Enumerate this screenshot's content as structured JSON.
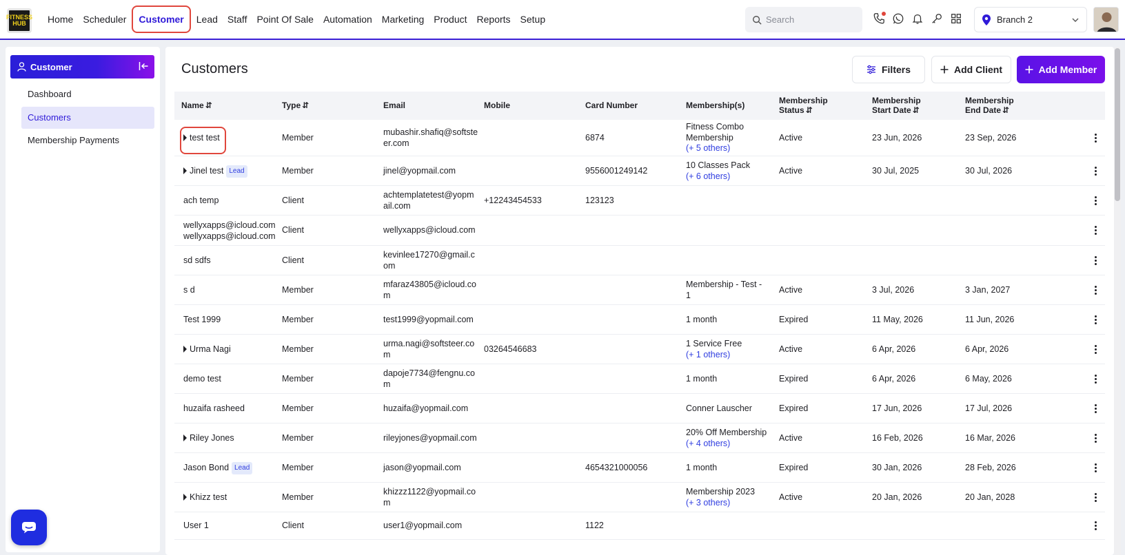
{
  "nav": {
    "logo_text": "FITNESS HUB",
    "items": [
      {
        "label": "Home",
        "active": false
      },
      {
        "label": "Scheduler",
        "active": false
      },
      {
        "label": "Customer",
        "active": true
      },
      {
        "label": "Lead",
        "active": false
      },
      {
        "label": "Staff",
        "active": false
      },
      {
        "label": "Point Of Sale",
        "active": false
      },
      {
        "label": "Automation",
        "active": false
      },
      {
        "label": "Marketing",
        "active": false
      },
      {
        "label": "Product",
        "active": false
      },
      {
        "label": "Reports",
        "active": false
      },
      {
        "label": "Setup",
        "active": false
      }
    ],
    "search_placeholder": "Search",
    "icons": [
      "phone-icon",
      "whatsapp-icon",
      "bell-icon",
      "key-icon",
      "grid-icon"
    ],
    "branch_label": "Branch 2"
  },
  "sidebar": {
    "title": "Customer",
    "items": [
      {
        "label": "Dashboard",
        "active": false
      },
      {
        "label": "Customers",
        "active": true
      },
      {
        "label": "Membership Payments",
        "active": false
      }
    ]
  },
  "main": {
    "title": "Customers",
    "filters_label": "Filters",
    "add_client_label": "Add Client",
    "add_member_label": "Add Member",
    "columns": {
      "name": "Name",
      "type": "Type",
      "email": "Email",
      "mobile": "Mobile",
      "card": "Card Number",
      "memberships": "Membership(s)",
      "status_1": "Membership",
      "status_2": "Status",
      "start_1": "Membership",
      "start_2": "Start Date",
      "end_1": "Membership",
      "end_2": "End Date",
      "sort_glyph": "⇵"
    },
    "lead_badge": "Lead",
    "rows": [
      {
        "name": "test test",
        "expand": true,
        "lead": false,
        "type": "Member",
        "email": "mubashir.shafiq@softsteer.com",
        "mobile": "",
        "card": "6874",
        "membership": "Fitness Combo Membership",
        "others": "(+ 5 others)",
        "status": "Active",
        "start": "23 Jun, 2026",
        "end": "23 Sep, 2026"
      },
      {
        "name": "Jinel test",
        "expand": true,
        "lead": true,
        "type": "Member",
        "email": "jinel@yopmail.com",
        "mobile": "",
        "card": "9556001249142",
        "membership": "10 Classes Pack",
        "others": "(+ 6 others)",
        "status": "Active",
        "start": "30 Jul, 2025",
        "end": "30 Jul, 2026"
      },
      {
        "name": "ach temp",
        "expand": false,
        "lead": false,
        "type": "Client",
        "email": "achtemplatetest@yopmail.com",
        "mobile": "+12243454533",
        "card": "123123",
        "membership": "",
        "others": "",
        "status": "",
        "start": "",
        "end": ""
      },
      {
        "name": "wellyxapps@icloud.com wellyxapps@icloud.com",
        "expand": false,
        "lead": false,
        "type": "Client",
        "email": "wellyxapps@icloud.com",
        "mobile": "",
        "card": "",
        "membership": "",
        "others": "",
        "status": "",
        "start": "",
        "end": ""
      },
      {
        "name": "sd sdfs",
        "expand": false,
        "lead": false,
        "type": "Client",
        "email": "kevinlee17270@gmail.com",
        "mobile": "",
        "card": "",
        "membership": "",
        "others": "",
        "status": "",
        "start": "",
        "end": ""
      },
      {
        "name": "s d",
        "expand": false,
        "lead": false,
        "type": "Member",
        "email": "mfaraz43805@icloud.com",
        "mobile": "",
        "card": "",
        "membership": "Membership - Test - 1",
        "others": "",
        "status": "Active",
        "start": "3 Jul, 2026",
        "end": "3 Jan, 2027"
      },
      {
        "name": "Test 1999",
        "expand": false,
        "lead": false,
        "type": "Member",
        "email": "test1999@yopmail.com",
        "mobile": "",
        "card": "",
        "membership": "1 month",
        "others": "",
        "status": "Expired",
        "start": "11 May, 2026",
        "end": "11 Jun, 2026"
      },
      {
        "name": "Urma Nagi",
        "expand": true,
        "lead": false,
        "type": "Member",
        "email": "urma.nagi@softsteer.com",
        "mobile": "03264546683",
        "card": "",
        "membership": "1 Service Free",
        "others": "(+ 1 others)",
        "status": "Active",
        "start": "6 Apr, 2026",
        "end": "6 Apr, 2026"
      },
      {
        "name": "demo test",
        "expand": false,
        "lead": false,
        "type": "Member",
        "email": "dapoje7734@fengnu.com",
        "mobile": "",
        "card": "",
        "membership": "1 month",
        "others": "",
        "status": "Expired",
        "start": "6 Apr, 2026",
        "end": "6 May, 2026"
      },
      {
        "name": "huzaifa rasheed",
        "expand": false,
        "lead": false,
        "type": "Member",
        "email": "huzaifa@yopmail.com",
        "mobile": "",
        "card": "",
        "membership": "Conner Lauscher",
        "others": "",
        "status": "Expired",
        "start": "17 Jun, 2026",
        "end": "17 Jul, 2026"
      },
      {
        "name": "Riley Jones",
        "expand": true,
        "lead": false,
        "type": "Member",
        "email": "rileyjones@yopmail.com",
        "mobile": "",
        "card": "",
        "membership": "20% Off Membership",
        "others": "(+ 4 others)",
        "status": "Active",
        "start": "16 Feb, 2026",
        "end": "16 Mar, 2026"
      },
      {
        "name": "Jason Bond",
        "expand": false,
        "lead": true,
        "type": "Member",
        "email": "jason@yopmail.com",
        "mobile": "",
        "card": "4654321000056",
        "membership": "1 month",
        "others": "",
        "status": "Expired",
        "start": "30 Jan, 2026",
        "end": "28 Feb, 2026"
      },
      {
        "name": "Khizz test",
        "expand": true,
        "lead": false,
        "type": "Member",
        "email": "khizzz1122@yopmail.com",
        "mobile": "",
        "card": "",
        "membership": "Membership 2023",
        "others": "(+ 3 others)",
        "status": "Active",
        "start": "20 Jan, 2026",
        "end": "20 Jan, 2028"
      },
      {
        "name": "User 1",
        "expand": false,
        "lead": false,
        "type": "Client",
        "email": "user1@yopmail.com",
        "mobile": "",
        "card": "1122",
        "membership": "",
        "others": "",
        "status": "",
        "start": "",
        "end": ""
      }
    ]
  },
  "colors": {
    "accent": "#2f1ad8",
    "highlight": "#e0463c",
    "link": "#2f3de0"
  }
}
